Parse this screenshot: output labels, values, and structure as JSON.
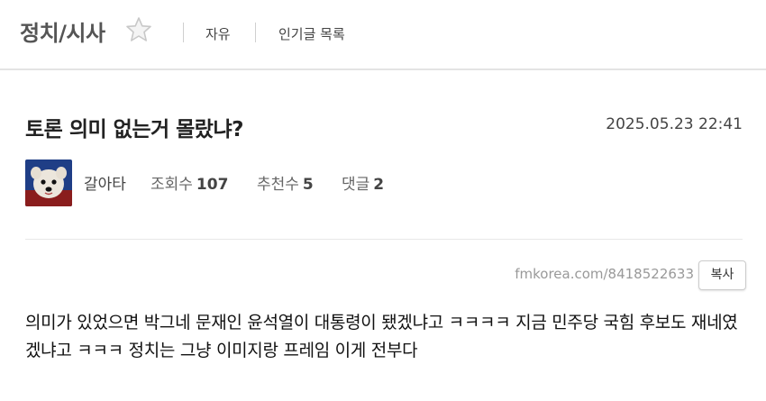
{
  "header": {
    "board_title": "정치/시사",
    "nav": [
      {
        "label": "자유"
      },
      {
        "label": "인기글 목록"
      }
    ]
  },
  "post": {
    "title": "토론 의미 없는거 몰랐냐?",
    "date": "2025.05.23 22:41",
    "author": "갈아타",
    "views_label": "조회수",
    "views": "107",
    "recommend_label": "추천수",
    "recommend": "5",
    "comments_label": "댓글",
    "comments": "2",
    "url": "fmkorea.com/8418522633",
    "copy_label": "복사",
    "body": "의미가 있었으면 박그네 문재인 윤석열이 대통령이 됐겠냐고 ㅋㅋㅋㅋ 지금 민주당 국힘 후보도 재네였겠냐고 ㅋㅋㅋ 정치는 그냥 이미지랑 프레임 이게 전부다"
  },
  "colors": {
    "title_gray": "#555555",
    "divider": "#e3e3e3"
  },
  "icons": {
    "favorite": "star-outline-icon",
    "avatar": "white-dog-avatar"
  }
}
